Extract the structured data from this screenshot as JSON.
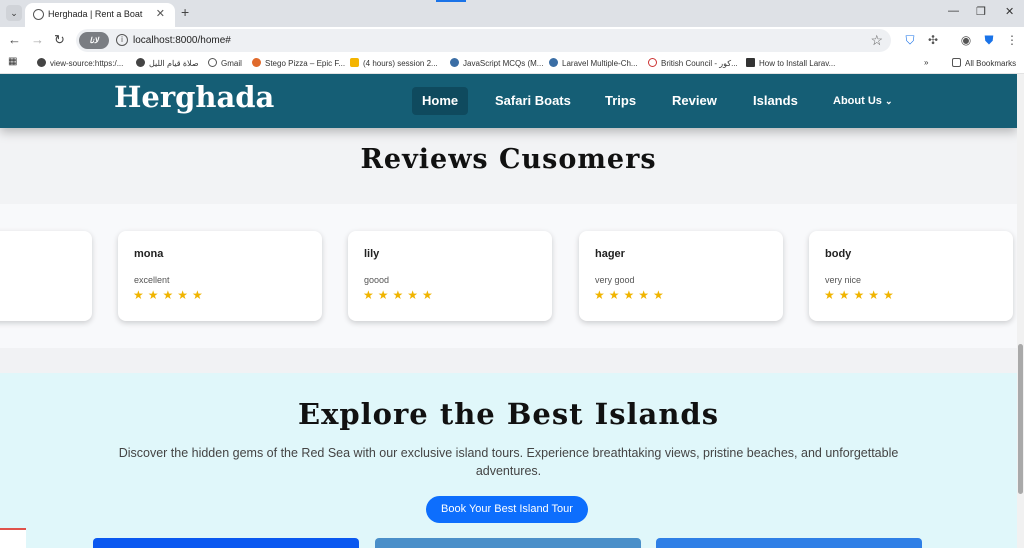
{
  "browser": {
    "tab_title": "Herghada | Rent a Boat",
    "url": "localhost:8000/home#",
    "site_pill": "ﻻﻧﺎ",
    "bookmarks": [
      "view-source:https:/...",
      "صلاة قيام الليل",
      "Gmail",
      "Stego Pizza – Epic F...",
      "(4 hours) session 2...",
      "JavaScript MCQs (M...",
      "Laravel Multiple-Ch...",
      "British Council - كور...",
      "How to Install Larav..."
    ],
    "all_bookmarks": "All Bookmarks"
  },
  "site": {
    "brand": "Herghada",
    "nav": [
      "Home",
      "Safari Boats",
      "Trips",
      "Review",
      "Islands",
      "About Us"
    ]
  },
  "reviews": {
    "title": "Reviews Cusomers",
    "cards": [
      {
        "name": "mona",
        "text": "excellent",
        "stars": 5
      },
      {
        "name": "lily",
        "text": "goood",
        "stars": 5
      },
      {
        "name": "hager",
        "text": "very good",
        "stars": 5
      },
      {
        "name": "body",
        "text": "very nice",
        "stars": 5
      }
    ]
  },
  "islands": {
    "title": "Explore the Best Islands",
    "description": "Discover the hidden gems of the Red Sea with our exclusive island tours. Experience breathtaking views, pristine beaches, and unforgettable adventures.",
    "button": "Book Your Best Island Tour"
  },
  "colors": {
    "nav_bg": "#155e75",
    "accent": "#0d6efd",
    "star": "#f0b400",
    "islands_bg": "#e0f7fa"
  },
  "icons": [
    "back-arrow-icon",
    "forward-arrow-icon",
    "reload-icon",
    "info-icon",
    "star-icon",
    "apps-grid-icon",
    "chevron-down-icon"
  ]
}
